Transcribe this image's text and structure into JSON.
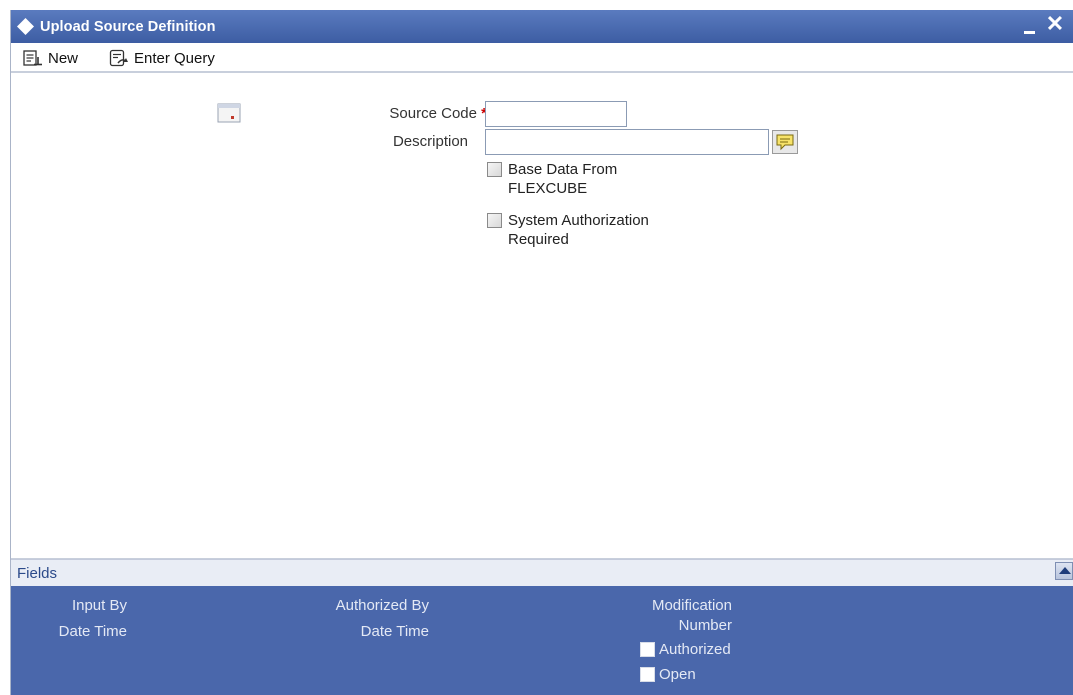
{
  "window": {
    "title": "Upload Source Definition",
    "close_glyph": "✕"
  },
  "toolbar": {
    "new_label": "New",
    "enter_query_label": "Enter Query"
  },
  "form": {
    "source_code": {
      "label": "Source Code",
      "required_mark": "*",
      "value": ""
    },
    "description": {
      "label": "Description",
      "value": ""
    },
    "base_data": {
      "label": "Base Data From FLEXCUBE",
      "checked": false
    },
    "system_auth": {
      "label": "System Authorization Required",
      "checked": false
    }
  },
  "fields_bar": {
    "label": "Fields"
  },
  "audit": {
    "input_by": "Input By",
    "input_date_time": "Date Time",
    "authorized_by": "Authorized By",
    "authorized_date_time": "Date Time",
    "modification": "Modification",
    "number": "Number",
    "authorized": "Authorized",
    "open": "Open"
  },
  "colors": {
    "titlebar": "#4a6bb0",
    "audit_panel": "#4a67ab",
    "required": "#cc0000"
  },
  "icons": [
    "diamond-icon",
    "minimize-icon",
    "close-icon",
    "new-icon",
    "enter-query-icon",
    "form-icon",
    "lov-icon",
    "collapse-icon"
  ]
}
